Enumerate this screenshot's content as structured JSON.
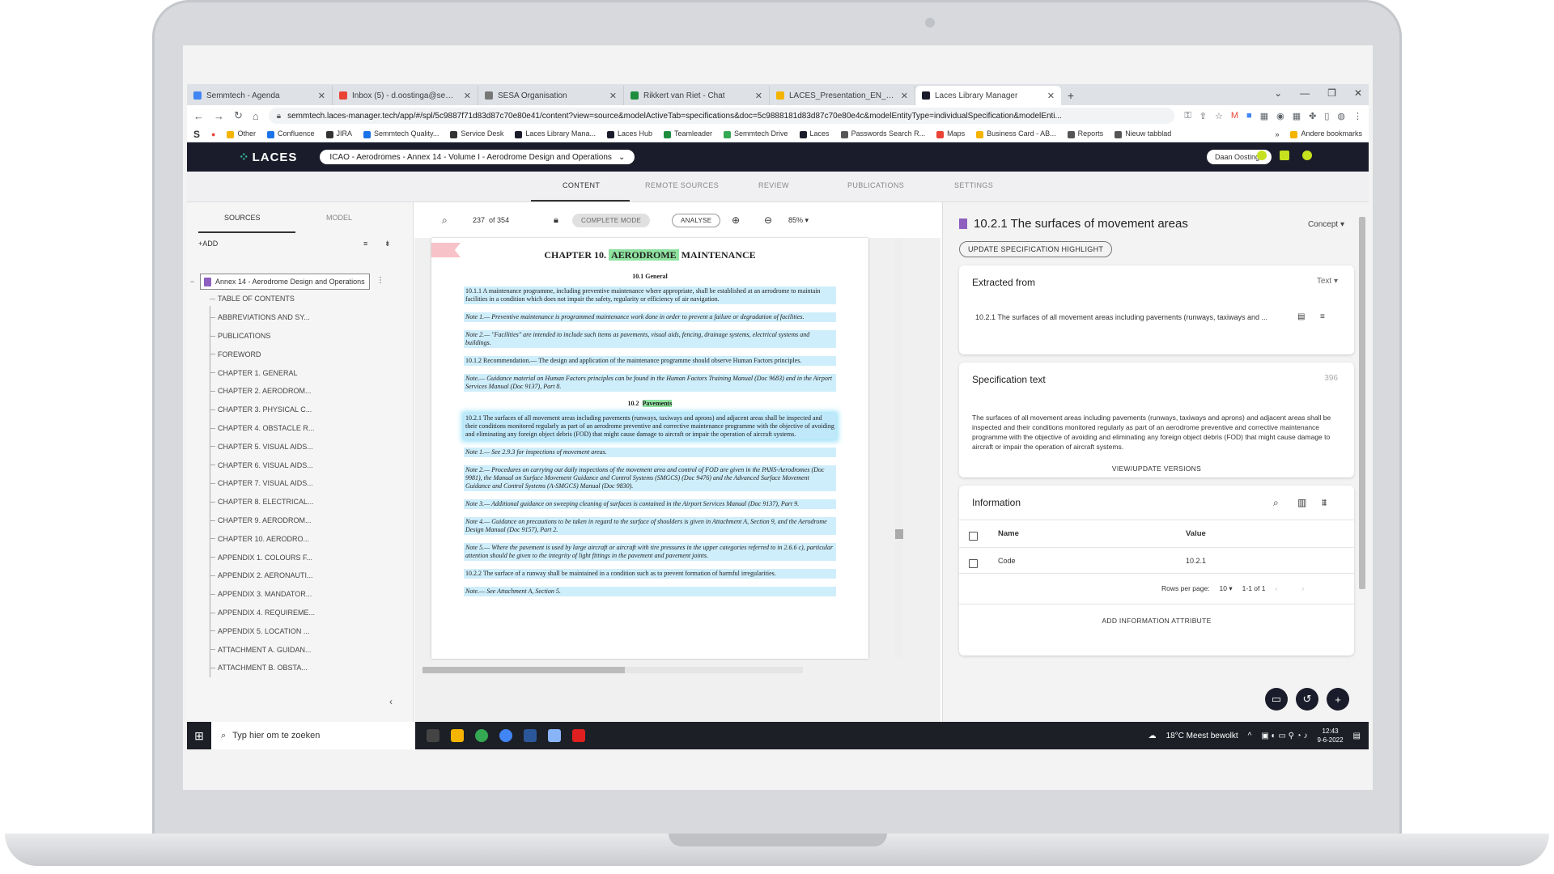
{
  "browser": {
    "tabs": [
      {
        "title": "Semmtech - Agenda",
        "color": "#4285f4"
      },
      {
        "title": "Inbox (5) - d.oostinga@semmtech",
        "color": "#ea4335"
      },
      {
        "title": "SESA Organisation",
        "color": "#777777"
      },
      {
        "title": "Rikkert van Riet - Chat",
        "color": "#1e8e3e"
      },
      {
        "title": "LACES_Presentation_EN_Product",
        "color": "#f4b400"
      },
      {
        "title": "Laces Library Manager",
        "color": "#1a1c2b"
      }
    ],
    "url": "semmtech.laces-manager.tech/app/#/spl/5c9887f71d83d87c70e80e41/content?view=source&modelActiveTab=specifications&doc=5c9888181d83d87c70e80e4c&modelEntityType=individualSpecification&modelEnti...",
    "bookmarks": [
      "Other",
      "Confluence",
      "JIRA",
      "Semmtech Quality...",
      "Service Desk",
      "Laces Library Mana...",
      "Laces Hub",
      "Teamleader",
      "Semmtech Drive",
      "Laces",
      "Passwords Search R...",
      "Maps",
      "Business Card - AB...",
      "Reports",
      "Nieuw tabblad",
      "Andere bookmarks"
    ]
  },
  "app": {
    "logo": "LACES",
    "project": "ICAO - Aerodromes - Annex 14 - Volume I - Aerodrome Design and Operations",
    "user": "Daan Oostinga",
    "nav": [
      "CONTENT",
      "REMOTE SOURCES",
      "REVIEW",
      "PUBLICATIONS",
      "SETTINGS"
    ]
  },
  "left": {
    "tab_sources": "SOURCES",
    "tab_model": "MODEL",
    "add": "ADD",
    "root": "Annex 14 - Aerodrome Design and Operations",
    "items": [
      "TABLE OF CONTENTS",
      "ABBREVIATIONS AND SY...",
      "PUBLICATIONS",
      "FOREWORD",
      "CHAPTER 1. GENERAL",
      "CHAPTER 2. AERODROM...",
      "CHAPTER 3. PHYSICAL C...",
      "CHAPTER 4. OBSTACLE R...",
      "CHAPTER 5. VISUAL AIDS...",
      "CHAPTER 6. VISUAL AIDS...",
      "CHAPTER 7. VISUAL AIDS...",
      "CHAPTER 8. ELECTRICAL...",
      "CHAPTER 9. AERODROM...",
      "CHAPTER 10. AERODRO...",
      "APPENDIX 1. COLOURS F...",
      "APPENDIX 2. AERONAUTI...",
      "APPENDIX 3. MANDATOR...",
      "APPENDIX 4. REQUIREME...",
      "APPENDIX 5. LOCATION ...",
      "ATTACHMENT A. GUIDAN...",
      "ATTACHMENT B. OBSTA..."
    ]
  },
  "doc": {
    "page": "237",
    "of": "of 354",
    "complete_mode": "COMPLETE MODE",
    "analyse": "ANALYSE",
    "zoom": "85%",
    "chapter_prefix": "CHAPTER 10.",
    "chapter_hl": "AERODROME",
    "chapter_suffix": "MAINTENANCE",
    "sec1": "10.1   General",
    "p1": "10.1.1   A maintenance programme, including preventive maintenance where appropriate, shall be established at an aerodrome to maintain facilities in a condition which does not impair the safety, regularity or efficiency of air navigation.",
    "n1": "Note 1.— Preventive maintenance is programmed maintenance work done in order to prevent a failure or degradation of facilities.",
    "n2": "Note 2.— \"Facilities\" are intended to include such items as pavements, visual aids, fencing, drainage systems, electrical systems and buildings.",
    "p2": "10.1.2   Recommendation.— The design and application of the maintenance programme should observe Human Factors principles.",
    "n3": "Note.— Guidance material on Human Factors principles can be found in the Human Factors Training Manual (Doc 9683) and in the Airport Services Manual (Doc 9137), Part 8.",
    "sec2_num": "10.2",
    "sec2_hl": "Pavements",
    "p3": "10.2.1   The surfaces of all movement areas including pavements (runways, taxiways and aprons) and adjacent areas shall be inspected and their conditions monitored regularly as part of an aerodrome preventive and corrective maintenance programme with the objective of avoiding and eliminating any foreign object debris (FOD) that might cause damage to aircraft or impair the operation of aircraft systems.",
    "n4": "Note 1.— See 2.9.3 for inspections of movement areas.",
    "n5": "Note 2.— Procedures on carrying out daily inspections of the movement area and control of FOD are given in the PANS-Aerodromes (Doc 9981), the Manual on Surface Movement Guidance and Control Systems (SMGCS) (Doc 9476) and the Advanced Surface Movement Guidance and Control Systems (A-SMGCS) Manual (Doc 9830).",
    "n6": "Note 3.— Additional guidance on sweeping cleaning of surfaces is contained in the Airport Services Manual (Doc 9137), Part 9.",
    "n7": "Note 4.— Guidance on precautions to be taken in regard to the surface of shoulders is given in Attachment A, Section 9, and the Aerodrome Design Manual (Doc 9157), Part 2.",
    "n8": "Note 5.— Where the pavement is used by large aircraft or aircraft with tire pressures in the upper categories referred to in 2.6.6 c), particular attention should be given to the integrity of light fittings in the pavement and pavement joints.",
    "p4": "10.2.2   The surface of a runway shall be maintained in a condition such as to prevent formation of harmful irregularities.",
    "n9": "Note.— See Attachment A, Section 5."
  },
  "right": {
    "title": "10.2.1 The surfaces of movement areas",
    "concept": "Concept",
    "update_btn": "UPDATE SPECIFICATION HIGHLIGHT",
    "extracted_title": "Extracted from",
    "extracted_type": "Text",
    "extracted_value": "10.2.1 The surfaces of all movement areas including pavements (runways, taxiways and ...",
    "spec_title": "Specification text",
    "spec_count": "396",
    "spec_text": "The surfaces of all movement areas including pavements (runways, taxiways and aprons) and adjacent areas shall be inspected and their conditions monitored regularly as part of an aerodrome preventive and corrective maintenance programme with the objective of avoiding and eliminating any foreign object debris (FOD) that might cause damage to aircraft or impair the operation of aircraft systems.",
    "versions_btn": "VIEW/UPDATE VERSIONS",
    "info_title": "Information",
    "col_name": "Name",
    "col_value": "Value",
    "row_name": "Code",
    "row_value": "10.2.1",
    "rows_per_page_label": "Rows per page:",
    "rows_per_page": "10",
    "range": "1-1 of 1",
    "add_attr": "ADD INFORMATION ATTRIBUTE"
  },
  "taskbar": {
    "search": "Typ hier om te zoeken",
    "weather": "18°C  Meest bewolkt",
    "time": "12:43",
    "date": "9-6-2022"
  }
}
